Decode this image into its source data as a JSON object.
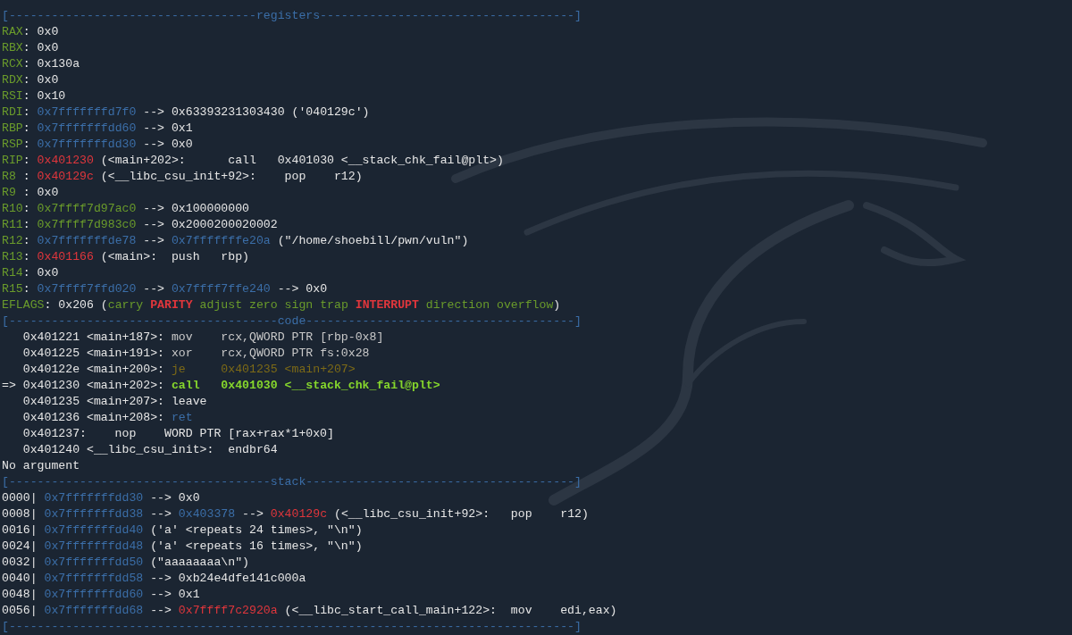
{
  "terminal": {
    "lines": [
      {
        "segments": [
          {
            "text": "[-----------------------------------registers------------------------------------]",
            "color": "#3b6ea8"
          }
        ]
      },
      {
        "segments": [
          {
            "text": "RAX",
            "color": "#6a9b2b"
          },
          {
            "text": ": 0x0",
            "color": "#e6e6e6"
          }
        ]
      },
      {
        "segments": [
          {
            "text": "RBX",
            "color": "#6a9b2b"
          },
          {
            "text": ": 0x0",
            "color": "#e6e6e6"
          }
        ]
      },
      {
        "segments": [
          {
            "text": "RCX",
            "color": "#6a9b2b"
          },
          {
            "text": ": 0x130a",
            "color": "#e6e6e6"
          }
        ]
      },
      {
        "segments": [
          {
            "text": "RDX",
            "color": "#6a9b2b"
          },
          {
            "text": ": 0x0",
            "color": "#e6e6e6"
          }
        ]
      },
      {
        "segments": [
          {
            "text": "RSI",
            "color": "#6a9b2b"
          },
          {
            "text": ": 0x10",
            "color": "#e6e6e6"
          }
        ]
      },
      {
        "segments": [
          {
            "text": "RDI",
            "color": "#6a9b2b"
          },
          {
            "text": ": ",
            "color": "#e6e6e6"
          },
          {
            "text": "0x7fffffffd7f0",
            "color": "#3b6ea8"
          },
          {
            "text": " --> 0x63393231303430 ('040129c')",
            "color": "#e6e6e6"
          }
        ]
      },
      {
        "segments": [
          {
            "text": "RBP",
            "color": "#6a9b2b"
          },
          {
            "text": ": ",
            "color": "#e6e6e6"
          },
          {
            "text": "0x7fffffffdd60",
            "color": "#3b6ea8"
          },
          {
            "text": " --> 0x1",
            "color": "#e6e6e6"
          }
        ]
      },
      {
        "segments": [
          {
            "text": "RSP",
            "color": "#6a9b2b"
          },
          {
            "text": ": ",
            "color": "#e6e6e6"
          },
          {
            "text": "0x7fffffffdd30",
            "color": "#3b6ea8"
          },
          {
            "text": " --> 0x0",
            "color": "#e6e6e6"
          }
        ]
      },
      {
        "segments": [
          {
            "text": "RIP",
            "color": "#6a9b2b"
          },
          {
            "text": ": ",
            "color": "#e6e6e6"
          },
          {
            "text": "0x401230",
            "color": "#e0363c"
          },
          {
            "text": " (<main+202>:      call   0x401030 <__stack_chk_fail@plt>)",
            "color": "#e6e6e6"
          }
        ]
      },
      {
        "segments": [
          {
            "text": "R8 ",
            "color": "#6a9b2b"
          },
          {
            "text": ": ",
            "color": "#e6e6e6"
          },
          {
            "text": "0x40129c",
            "color": "#e0363c"
          },
          {
            "text": " (<__libc_csu_init+92>:    pop    r12)",
            "color": "#e6e6e6"
          }
        ]
      },
      {
        "segments": [
          {
            "text": "R9 ",
            "color": "#6a9b2b"
          },
          {
            "text": ": 0x0",
            "color": "#e6e6e6"
          }
        ]
      },
      {
        "segments": [
          {
            "text": "R10",
            "color": "#6a9b2b"
          },
          {
            "text": ": ",
            "color": "#e6e6e6"
          },
          {
            "text": "0x7ffff7d97ac0",
            "color": "#6a9b2b"
          },
          {
            "text": " --> 0x100000000",
            "color": "#e6e6e6"
          }
        ]
      },
      {
        "segments": [
          {
            "text": "R11",
            "color": "#6a9b2b"
          },
          {
            "text": ": ",
            "color": "#e6e6e6"
          },
          {
            "text": "0x7ffff7d983c0",
            "color": "#6a9b2b"
          },
          {
            "text": " --> 0x2000200020002",
            "color": "#e6e6e6"
          }
        ]
      },
      {
        "segments": [
          {
            "text": "R12",
            "color": "#6a9b2b"
          },
          {
            "text": ": ",
            "color": "#e6e6e6"
          },
          {
            "text": "0x7fffffffde78",
            "color": "#3b6ea8"
          },
          {
            "text": " --> ",
            "color": "#e6e6e6"
          },
          {
            "text": "0x7fffffffe20a",
            "color": "#3b6ea8"
          },
          {
            "text": " (\"/home/shoebill/pwn/vuln\")",
            "color": "#e6e6e6"
          }
        ]
      },
      {
        "segments": [
          {
            "text": "R13",
            "color": "#6a9b2b"
          },
          {
            "text": ": ",
            "color": "#e6e6e6"
          },
          {
            "text": "0x401166",
            "color": "#e0363c"
          },
          {
            "text": " (<main>:  push   rbp)",
            "color": "#e6e6e6"
          }
        ]
      },
      {
        "segments": [
          {
            "text": "R14",
            "color": "#6a9b2b"
          },
          {
            "text": ": 0x0",
            "color": "#e6e6e6"
          }
        ]
      },
      {
        "segments": [
          {
            "text": "R15",
            "color": "#6a9b2b"
          },
          {
            "text": ": ",
            "color": "#e6e6e6"
          },
          {
            "text": "0x7ffff7ffd020",
            "color": "#3b6ea8"
          },
          {
            "text": " --> ",
            "color": "#e6e6e6"
          },
          {
            "text": "0x7ffff7ffe240",
            "color": "#3b6ea8"
          },
          {
            "text": " --> 0x0",
            "color": "#e6e6e6"
          }
        ]
      },
      {
        "segments": [
          {
            "text": "EFLAGS",
            "color": "#6a9b2b"
          },
          {
            "text": ": 0x206 (",
            "color": "#e6e6e6"
          },
          {
            "text": "carry ",
            "color": "#6a9b2b"
          },
          {
            "text": "PARITY",
            "color": "#e0363c",
            "bold": true
          },
          {
            "text": " adjust zero sign trap ",
            "color": "#6a9b2b"
          },
          {
            "text": "INTERRUPT",
            "color": "#e0363c",
            "bold": true
          },
          {
            "text": " direction overflow",
            "color": "#6a9b2b"
          },
          {
            "text": ")",
            "color": "#e6e6e6"
          }
        ]
      },
      {
        "segments": [
          {
            "text": "[--------------------------------------code--------------------------------------]",
            "color": "#3b6ea8"
          }
        ]
      },
      {
        "segments": [
          {
            "text": "   0x401221 <main+187>: ",
            "color": "#e6e6e6"
          },
          {
            "text": "mov    rcx,QWORD PTR [rbp-0x8]",
            "color": "#c9c9c9"
          }
        ]
      },
      {
        "segments": [
          {
            "text": "   0x401225 <main+191>: ",
            "color": "#e6e6e6"
          },
          {
            "text": "xor    rcx,QWORD PTR fs:0x28",
            "color": "#c9c9c9"
          }
        ]
      },
      {
        "segments": [
          {
            "text": "   0x40122e <main+200>: ",
            "color": "#e6e6e6"
          },
          {
            "text": "je     0x401235 <main+207>",
            "color": "#7d6a16"
          }
        ]
      },
      {
        "segments": [
          {
            "text": "=> 0x401230 <main+202>: ",
            "color": "#e6e6e6"
          },
          {
            "text": "call   0x401030 <__stack_chk_fail@plt>",
            "color": "#86d72c",
            "bold": true
          }
        ]
      },
      {
        "segments": [
          {
            "text": "   0x401235 <main+207>: leave",
            "color": "#e6e6e6"
          }
        ]
      },
      {
        "segments": [
          {
            "text": "   0x401236 <main+208>: ",
            "color": "#e6e6e6"
          },
          {
            "text": "ret",
            "color": "#3b6ea8"
          }
        ]
      },
      {
        "segments": [
          {
            "text": "   0x401237:    nop    WORD PTR [rax+rax*1+0x0]",
            "color": "#e6e6e6"
          }
        ]
      },
      {
        "segments": [
          {
            "text": "   0x401240 <__libc_csu_init>:  endbr64",
            "color": "#e6e6e6"
          }
        ]
      },
      {
        "segments": [
          {
            "text": "No argument",
            "color": "#e6e6e6"
          }
        ]
      },
      {
        "segments": [
          {
            "text": "[-------------------------------------stack--------------------------------------]",
            "color": "#3b6ea8"
          }
        ]
      },
      {
        "segments": [
          {
            "text": "0000| ",
            "color": "#e6e6e6"
          },
          {
            "text": "0x7fffffffdd30",
            "color": "#3b6ea8"
          },
          {
            "text": " --> 0x0",
            "color": "#e6e6e6"
          }
        ]
      },
      {
        "segments": [
          {
            "text": "0008| ",
            "color": "#e6e6e6"
          },
          {
            "text": "0x7fffffffdd38",
            "color": "#3b6ea8"
          },
          {
            "text": " --> ",
            "color": "#e6e6e6"
          },
          {
            "text": "0x403378",
            "color": "#3b6ea8"
          },
          {
            "text": " --> ",
            "color": "#e6e6e6"
          },
          {
            "text": "0x40129c",
            "color": "#e0363c"
          },
          {
            "text": " (<__libc_csu_init+92>:   pop    r12)",
            "color": "#e6e6e6"
          }
        ]
      },
      {
        "segments": [
          {
            "text": "0016| ",
            "color": "#e6e6e6"
          },
          {
            "text": "0x7fffffffdd40",
            "color": "#3b6ea8"
          },
          {
            "text": " ('a' <repeats 24 times>, \"\\n\")",
            "color": "#e6e6e6"
          }
        ]
      },
      {
        "segments": [
          {
            "text": "0024| ",
            "color": "#e6e6e6"
          },
          {
            "text": "0x7fffffffdd48",
            "color": "#3b6ea8"
          },
          {
            "text": " ('a' <repeats 16 times>, \"\\n\")",
            "color": "#e6e6e6"
          }
        ]
      },
      {
        "segments": [
          {
            "text": "0032| ",
            "color": "#e6e6e6"
          },
          {
            "text": "0x7fffffffdd50",
            "color": "#3b6ea8"
          },
          {
            "text": " (\"aaaaaaaa\\n\")",
            "color": "#e6e6e6"
          }
        ]
      },
      {
        "segments": [
          {
            "text": "0040| ",
            "color": "#e6e6e6"
          },
          {
            "text": "0x7fffffffdd58",
            "color": "#3b6ea8"
          },
          {
            "text": " --> 0xb24e4dfe141c000a",
            "color": "#e6e6e6"
          }
        ]
      },
      {
        "segments": [
          {
            "text": "0048| ",
            "color": "#e6e6e6"
          },
          {
            "text": "0x7fffffffdd60",
            "color": "#3b6ea8"
          },
          {
            "text": " --> 0x1",
            "color": "#e6e6e6"
          }
        ]
      },
      {
        "segments": [
          {
            "text": "0056| ",
            "color": "#e6e6e6"
          },
          {
            "text": "0x7fffffffdd68",
            "color": "#3b6ea8"
          },
          {
            "text": " --> ",
            "color": "#e6e6e6"
          },
          {
            "text": "0x7ffff7c2920a",
            "color": "#e0363c"
          },
          {
            "text": " (<__libc_start_call_main+122>:  mov    edi,eax)",
            "color": "#e6e6e6"
          }
        ]
      },
      {
        "segments": [
          {
            "text": "[--------------------------------------------------------------------------------]",
            "color": "#3b6ea8"
          }
        ]
      }
    ]
  }
}
